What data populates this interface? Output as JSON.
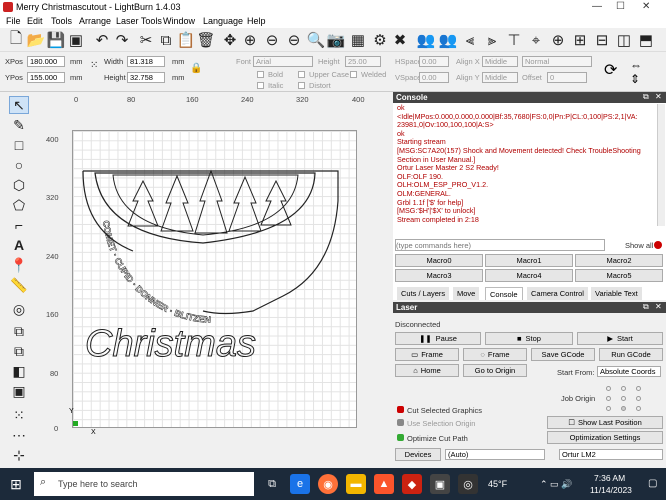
{
  "window": {
    "title": "Merry Christmascutout - LightBurn 1.4.03",
    "controls": [
      "—",
      "☐",
      "✕"
    ]
  },
  "menu": [
    "File",
    "Edit",
    "Tools",
    "Arrange",
    "Laser Tools",
    "Window",
    "Language",
    "Help"
  ],
  "props": {
    "xpos_label": "XPos",
    "xpos": "180.000",
    "ypos_label": "YPos",
    "ypos": "155.000",
    "unit": "mm",
    "width_label": "Width",
    "width": "81.318",
    "height_label": "Height",
    "height": "32.758",
    "font_label": "Font",
    "font": "Arial",
    "size_label": "Height",
    "size": "25.00",
    "bold": "Bold",
    "italic": "Italic",
    "upper": "Upper Case",
    "distort": "Distort",
    "welded": "Welded",
    "hspace_label": "HSpace",
    "hspace": "0.00",
    "vspace_label": "VSpace",
    "vspace": "0.00",
    "alignx_label": "Align X",
    "alignx": "Middle",
    "aligny_label": "Align Y",
    "aligny": "Middle",
    "mode": "Normal",
    "offset_label": "Offset",
    "offset": "0"
  },
  "ruler": {
    "x": [
      "0",
      "80",
      "160",
      "240",
      "320",
      "400"
    ],
    "y": [
      "400",
      "320",
      "240",
      "160",
      "80",
      "0"
    ],
    "origin_x": "X",
    "origin_y": "Y"
  },
  "design": {
    "arc_top": "DASHER · DANCER · PRANCER · VIXEN",
    "arc_bottom": "COMET · CUPID · DONNER · BLITZEN",
    "script": "Christmas"
  },
  "console": {
    "title": "Console",
    "lines": [
      "ok",
      "<Idle|MPos:0.000,0.000,0.000|Bf:35,7680|FS:0,0|Pn:P|CL:0,100|PS:2,1|VA:",
      "23981,0|Ov:100,100,100|A:S>",
      "ok",
      "Starting stream",
      "[MSG:SC7A20(157) Shock and Movement detected! Check TroubleShooting",
      "Section in User Manual.]",
      "Ortur Laser Master 2 S2 Ready!",
      "OLF:OLF 190.",
      "OLH:OLM_ESP_PRO_V1.2.",
      "OLM:GENERAL.",
      "Grbl 1.1f ['$' for help]",
      "[MSG:'$H'|'$X' to unlock]",
      "Stream completed in 2:18"
    ],
    "input_placeholder": "(type commands here)",
    "show_all": "Show all",
    "macros": [
      "Macro0",
      "Macro1",
      "Macro2",
      "Macro3",
      "Macro4",
      "Macro5"
    ],
    "tabs": [
      "Cuts / Layers",
      "Move",
      "Console",
      "Camera Control",
      "Variable Text"
    ]
  },
  "laser": {
    "title": "Laser",
    "status": "Disconnected",
    "pause": "Pause",
    "stop": "Stop",
    "start": "Start",
    "frame1": "Frame",
    "frame2": "Frame",
    "save_gcode": "Save GCode",
    "run_gcode": "Run GCode",
    "home": "Home",
    "go_origin": "Go to Origin",
    "start_from_label": "Start From:",
    "start_from": "Absolute Coords",
    "job_origin": "Job Origin",
    "cut_selected": "Cut Selected Graphics",
    "use_selection": "Use Selection Origin",
    "show_last": "Show Last Position",
    "optimize_cut": "Optimize Cut Path",
    "optimization": "Optimization Settings",
    "devices": "Devices",
    "port": "(Auto)",
    "device": "Ortur LM2"
  },
  "taskbar": {
    "search_placeholder": "Type here to search",
    "temp": "45°F",
    "time": "7:36 AM",
    "date": "11/14/2023"
  },
  "colors": {
    "accent": "#1c2a3a",
    "console_text": "#b00000",
    "panel_title": "#444444"
  }
}
